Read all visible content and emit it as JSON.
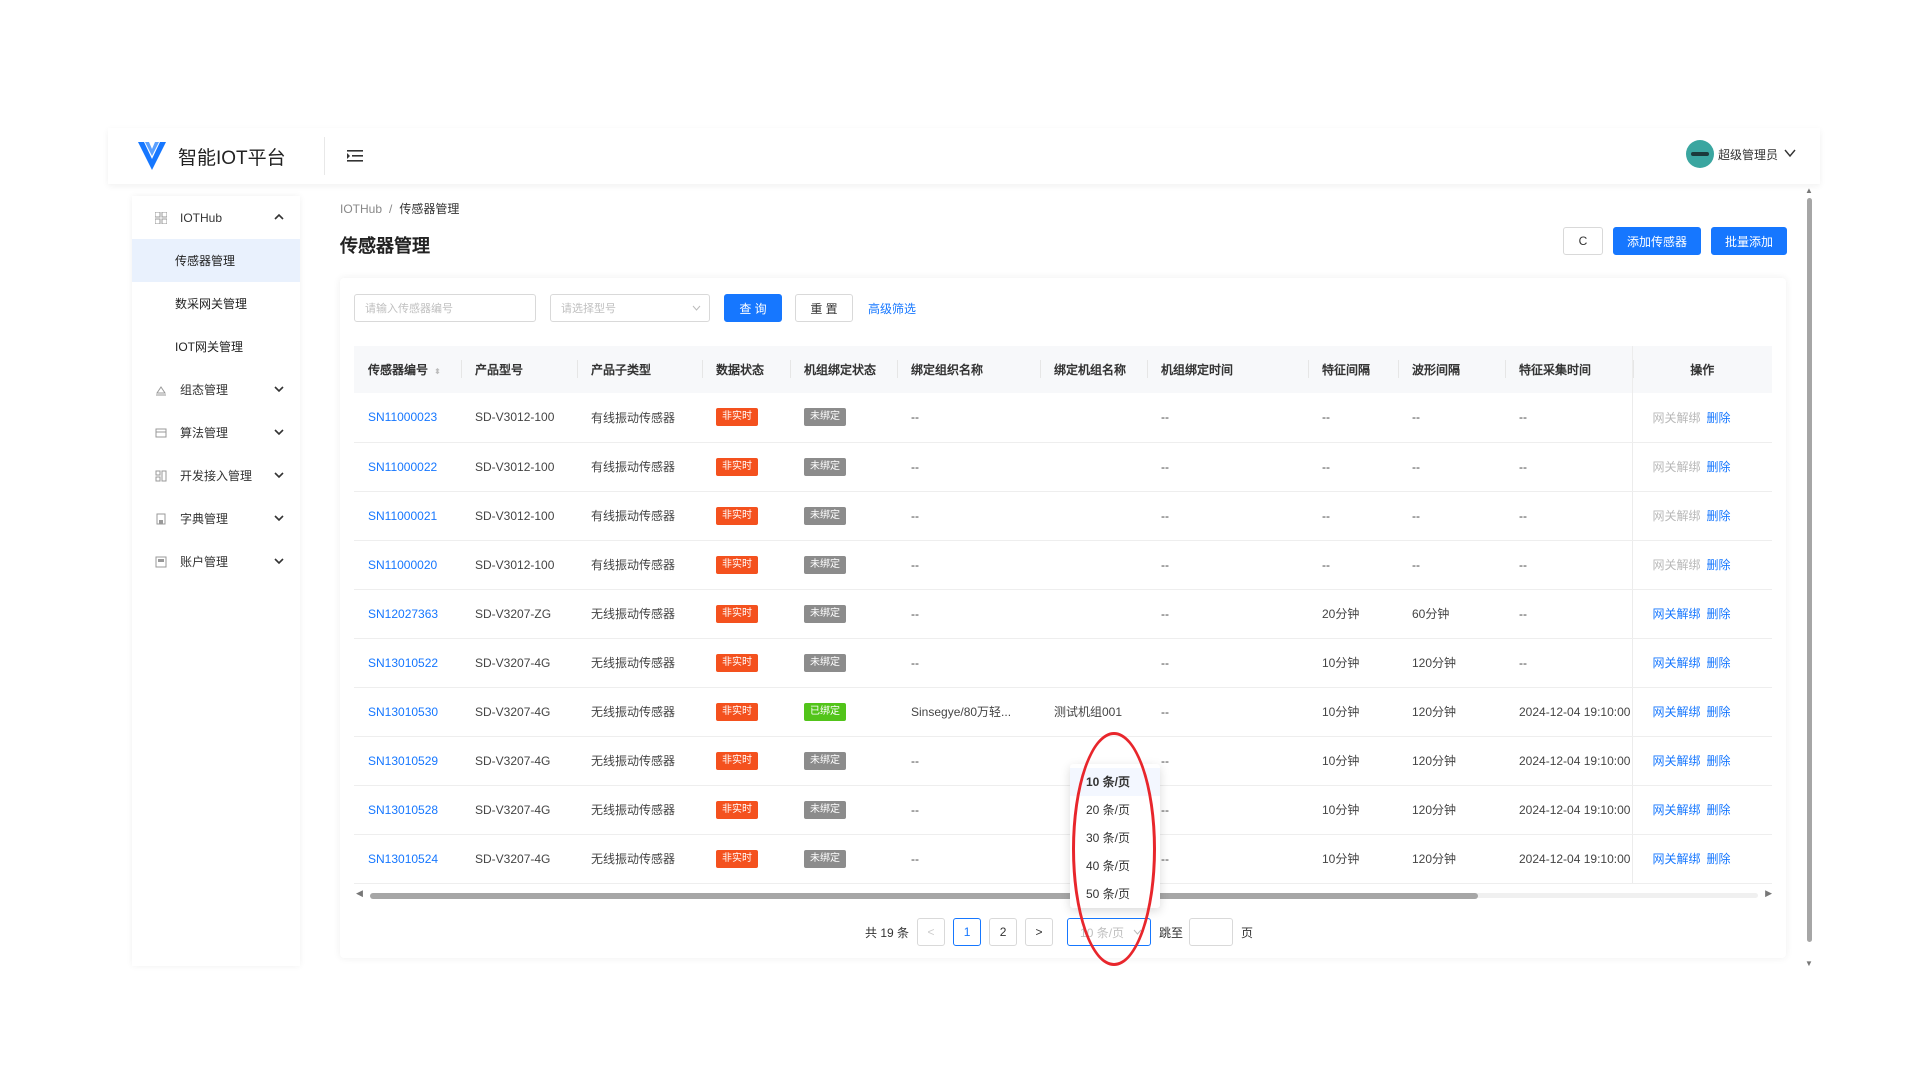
{
  "header": {
    "logo_text": "智能IOT平台",
    "user_name": "超级管理员",
    "brand_color": "#1677ff"
  },
  "sidebar": {
    "iothub": "IOTHub",
    "sub_items": [
      "传感器管理",
      "数采网关管理",
      "IOT网关管理"
    ],
    "groups": [
      "组态管理",
      "算法管理",
      "开发接入管理",
      "字典管理",
      "账户管理"
    ]
  },
  "breadcrumb": {
    "root": "IOTHub",
    "sep": "/",
    "current": "传感器管理"
  },
  "page": {
    "title": "传感器管理",
    "refresh_icon": "C",
    "add_label": "添加传感器",
    "batch_label": "批量添加"
  },
  "filters": {
    "sn_placeholder": "请输入传感器编号",
    "model_placeholder": "请选择型号",
    "query_label": "查 询",
    "reset_label": "重 置",
    "advanced_label": "高级筛选"
  },
  "table": {
    "columns": [
      "传感器编号",
      "产品型号",
      "产品子类型",
      "数据状态",
      "机组绑定状态",
      "绑定组织名称",
      "绑定机组名称",
      "机组绑定时间",
      "特征间隔",
      "波形间隔",
      "特征采集时间",
      "操作"
    ],
    "op_unbind": "网关解绑",
    "op_delete": "删除",
    "rows": [
      {
        "sn": "SN11000023",
        "model": "SD-V3012-100",
        "subtype": "有线振动传感器",
        "data": "非实时",
        "bind": "未绑定",
        "bind_type": "gray",
        "org": "--",
        "unit": "",
        "bind_time": "--",
        "feat": "--",
        "wave": "--",
        "collect": "--",
        "unbind_enabled": false
      },
      {
        "sn": "SN11000022",
        "model": "SD-V3012-100",
        "subtype": "有线振动传感器",
        "data": "非实时",
        "bind": "未绑定",
        "bind_type": "gray",
        "org": "--",
        "unit": "",
        "bind_time": "--",
        "feat": "--",
        "wave": "--",
        "collect": "--",
        "unbind_enabled": false
      },
      {
        "sn": "SN11000021",
        "model": "SD-V3012-100",
        "subtype": "有线振动传感器",
        "data": "非实时",
        "bind": "未绑定",
        "bind_type": "gray",
        "org": "--",
        "unit": "",
        "bind_time": "--",
        "feat": "--",
        "wave": "--",
        "collect": "--",
        "unbind_enabled": false
      },
      {
        "sn": "SN11000020",
        "model": "SD-V3012-100",
        "subtype": "有线振动传感器",
        "data": "非实时",
        "bind": "未绑定",
        "bind_type": "gray",
        "org": "--",
        "unit": "",
        "bind_time": "--",
        "feat": "--",
        "wave": "--",
        "collect": "--",
        "unbind_enabled": false
      },
      {
        "sn": "SN12027363",
        "model": "SD-V3207-ZG",
        "subtype": "无线振动传感器",
        "data": "非实时",
        "bind": "未绑定",
        "bind_type": "gray",
        "org": "--",
        "unit": "",
        "bind_time": "--",
        "feat": "20分钟",
        "wave": "60分钟",
        "collect": "--",
        "unbind_enabled": true
      },
      {
        "sn": "SN13010522",
        "model": "SD-V3207-4G",
        "subtype": "无线振动传感器",
        "data": "非实时",
        "bind": "未绑定",
        "bind_type": "gray",
        "org": "--",
        "unit": "",
        "bind_time": "--",
        "feat": "10分钟",
        "wave": "120分钟",
        "collect": "--",
        "unbind_enabled": true
      },
      {
        "sn": "SN13010530",
        "model": "SD-V3207-4G",
        "subtype": "无线振动传感器",
        "data": "非实时",
        "bind": "已绑定",
        "bind_type": "green",
        "org": "Sinsegye/80万轻...",
        "unit": "测试机组001",
        "bind_time": "--",
        "feat": "10分钟",
        "wave": "120分钟",
        "collect": "2024-12-04 19:10:00",
        "unbind_enabled": true
      },
      {
        "sn": "SN13010529",
        "model": "SD-V3207-4G",
        "subtype": "无线振动传感器",
        "data": "非实时",
        "bind": "未绑定",
        "bind_type": "gray",
        "org": "--",
        "unit": "",
        "bind_time": "--",
        "feat": "10分钟",
        "wave": "120分钟",
        "collect": "2024-12-04 19:10:00",
        "unbind_enabled": true
      },
      {
        "sn": "SN13010528",
        "model": "SD-V3207-4G",
        "subtype": "无线振动传感器",
        "data": "非实时",
        "bind": "未绑定",
        "bind_type": "gray",
        "org": "--",
        "unit": "",
        "bind_time": "--",
        "feat": "10分钟",
        "wave": "120分钟",
        "collect": "2024-12-04 19:10:00",
        "unbind_enabled": true
      },
      {
        "sn": "SN13010524",
        "model": "SD-V3207-4G",
        "subtype": "无线振动传感器",
        "data": "非实时",
        "bind": "未绑定",
        "bind_type": "gray",
        "org": "--",
        "unit": "",
        "bind_time": "--",
        "feat": "10分钟",
        "wave": "120分钟",
        "collect": "2024-12-04 19:10:00",
        "unbind_enabled": true
      }
    ]
  },
  "pagination": {
    "total": "共 19 条",
    "prev": "<",
    "pages": [
      "1",
      "2"
    ],
    "next": ">",
    "size_value": "10 条/页",
    "jump_label": "跳至",
    "page_label": "页",
    "size_options": [
      "10 条/页",
      "20 条/页",
      "30 条/页",
      "40 条/页",
      "50 条/页"
    ]
  },
  "colors": {
    "tag_red": "#f4511e",
    "tag_gray": "#8c8c8c",
    "tag_green": "#52c41a",
    "highlight": "#e8262c"
  }
}
